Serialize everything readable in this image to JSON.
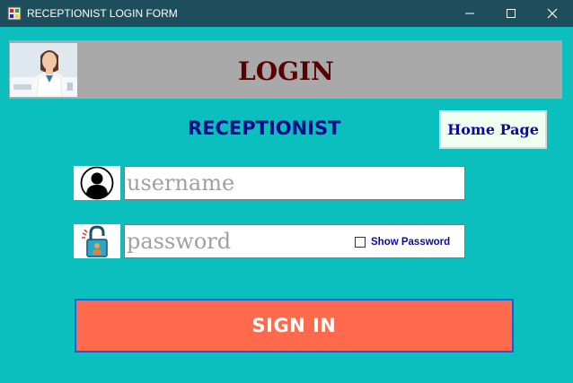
{
  "window": {
    "title": "RECEPTIONIST LOGIN FORM",
    "controls": [
      "minimize-icon",
      "maximize-icon",
      "close-icon"
    ]
  },
  "header": {
    "title": "LOGIN",
    "photo": "receptionist-photo"
  },
  "subtitle": "RECEPTIONIST",
  "home_button": {
    "label": "Home Page"
  },
  "username": {
    "placeholder": "username",
    "value": "",
    "icon": "user-icon"
  },
  "password": {
    "placeholder": "password",
    "value": "",
    "icon": "lock-icon"
  },
  "show_password": {
    "label": "Show Password",
    "checked": false
  },
  "signin_button": {
    "label": "SIGN IN"
  },
  "colors": {
    "background": "#0cbfbf",
    "titlebar": "#1e4d5c",
    "header_band": "#a9a9a9",
    "header_title": "#5a0000",
    "subtitle": "#0a0a8a",
    "signin": "#ff6a4d",
    "signin_border": "#1e5bd8"
  }
}
